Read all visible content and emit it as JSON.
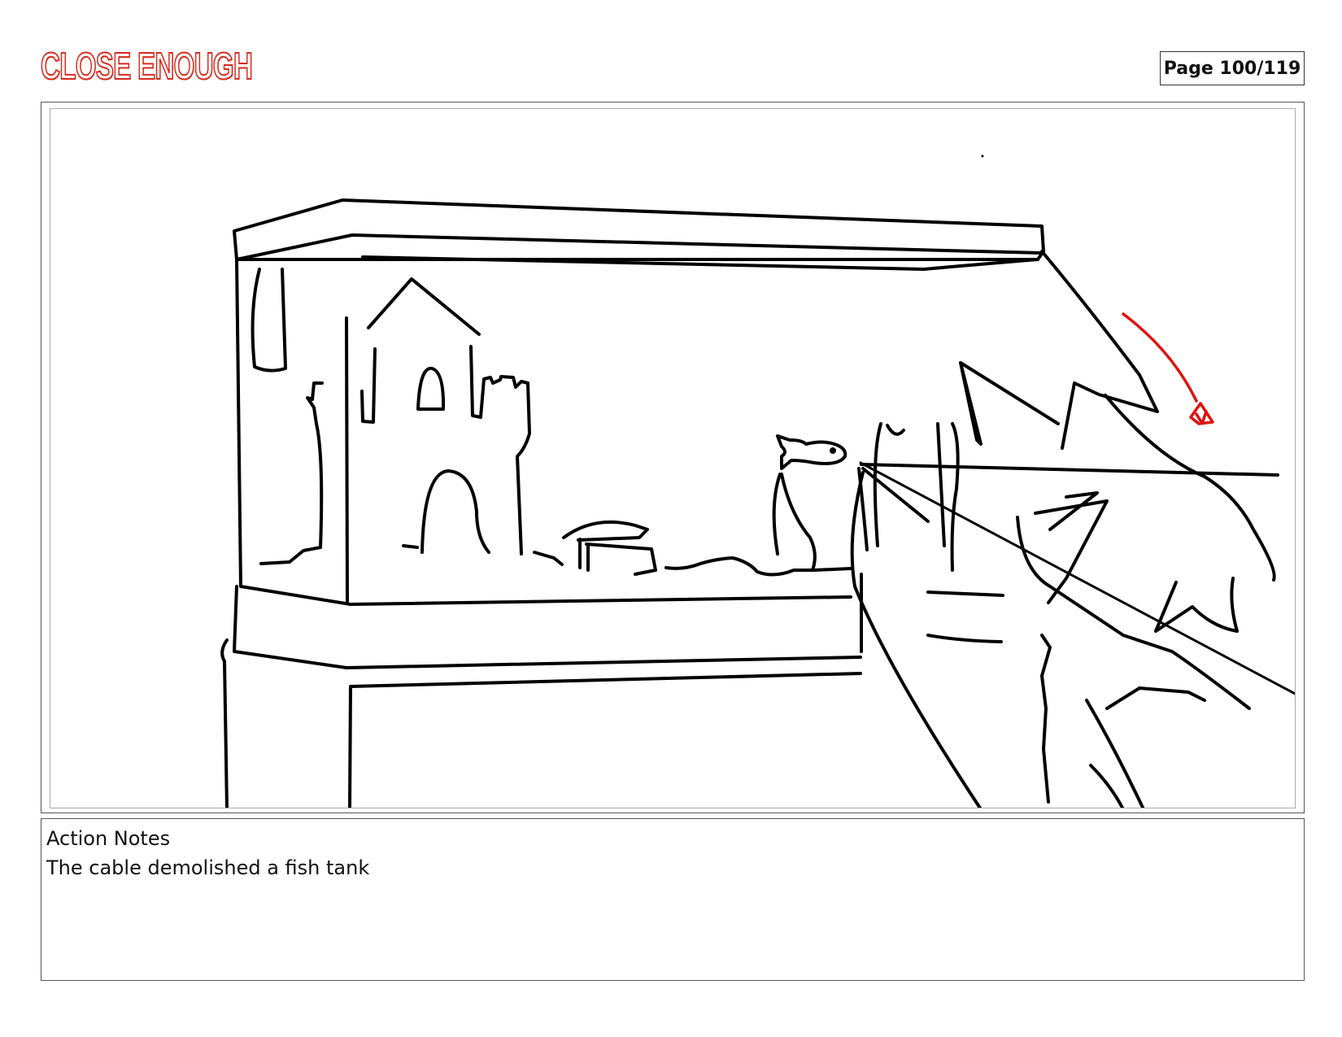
{
  "header": {
    "logo_text": "CLOSE ENOUGH",
    "page_label": "Page 100/119"
  },
  "panel": {
    "drawing": "storyboard-sketch-fish-tank",
    "accent_color": "#e01010"
  },
  "notes": {
    "title": "Action Notes",
    "text": "The cable demolished a fish tank"
  }
}
